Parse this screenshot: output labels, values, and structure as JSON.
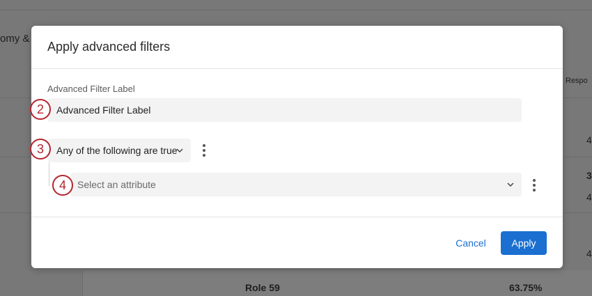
{
  "background": {
    "left_text": "omy &",
    "right_header": "Respo",
    "right_values": [
      "4",
      "3",
      "4",
      "4"
    ],
    "bottom_role": "Role 59",
    "bottom_percent": "63.75%"
  },
  "modal": {
    "title": "Apply advanced filters",
    "label_field": {
      "label": "Advanced Filter Label",
      "value": "Advanced Filter Label"
    },
    "condition_select": {
      "value": "Any of the following are true"
    },
    "attribute_select": {
      "placeholder": "Select an attribute"
    },
    "cancel_label": "Cancel",
    "apply_label": "Apply"
  },
  "markers": [
    "2",
    "3",
    "4"
  ],
  "colors": {
    "accent": "#1a6fd1",
    "marker": "#b3262f"
  },
  "icons": {
    "condition_dropdown": "chevron-down-icon",
    "attribute_dropdown": "chevron-down-icon",
    "condition_menu": "kebab-menu-icon",
    "attribute_menu": "kebab-menu-icon"
  }
}
